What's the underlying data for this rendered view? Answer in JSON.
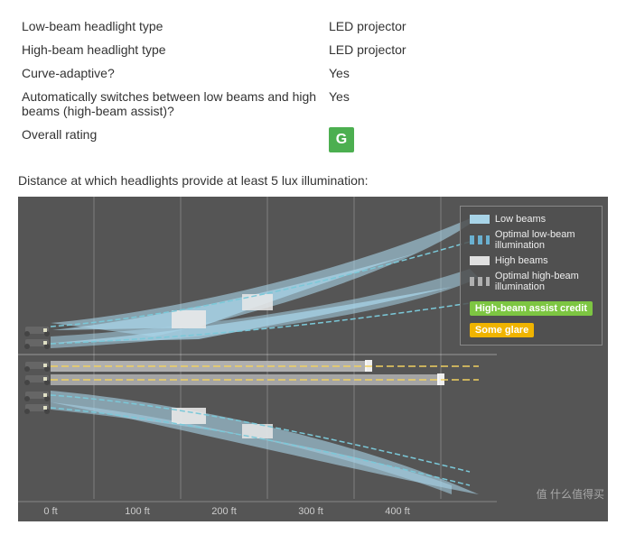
{
  "specs": {
    "rows": [
      {
        "label": "Low-beam headlight type",
        "value": "LED projector"
      },
      {
        "label": "High-beam headlight type",
        "value": "LED projector"
      },
      {
        "label": "Curve-adaptive?",
        "value": "Yes"
      },
      {
        "label": "Automatically switches between low beams and high beams (high-beam assist)?",
        "value": "Yes"
      },
      {
        "label": "Overall rating",
        "value": "G",
        "is_rating": true
      }
    ]
  },
  "chart": {
    "title": "Distance at which headlights provide at least 5 lux illumination:",
    "x_labels": [
      "0 ft",
      "100 ft",
      "200 ft",
      "300 ft",
      "400 ft"
    ],
    "legend": {
      "items": [
        {
          "label": "Low beams",
          "color": "#a8d4e8",
          "type": "solid"
        },
        {
          "label": "Optimal low-beam illumination",
          "color": "#6ab0d0",
          "type": "dashed"
        },
        {
          "label": "High beams",
          "color": "#e0e0e0",
          "type": "solid"
        },
        {
          "label": "Optimal high-beam illumination",
          "color": "#b0b0b0",
          "type": "dashed"
        }
      ],
      "badges": [
        {
          "label": "High-beam assist credit",
          "class": "legend-green"
        },
        {
          "label": "Some glare",
          "class": "legend-yellow"
        }
      ]
    }
  },
  "watermark": "值 什么值得买"
}
